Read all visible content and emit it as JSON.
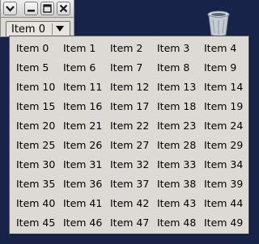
{
  "window": {
    "menu_icon": "chevron-down-icon",
    "minimize_icon": "minimize-icon",
    "maximize_icon": "maximize-icon",
    "close_icon": "close-icon"
  },
  "combo": {
    "selected": "Item 0",
    "arrow_icon": "dropdown-arrow-icon"
  },
  "desktop": {
    "trash_icon": "trash-icon",
    "background_color": "#18234a"
  },
  "popup": {
    "items": [
      "Item 0",
      "Item 1",
      "Item 2",
      "Item 3",
      "Item 4",
      "Item 5",
      "Item 6",
      "Item 7",
      "Item 8",
      "Item 9",
      "Item 10",
      "Item 11",
      "Item 12",
      "Item 13",
      "Item 14",
      "Item 15",
      "Item 16",
      "Item 17",
      "Item 18",
      "Item 19",
      "Item 20",
      "Item 21",
      "Item 22",
      "Item 23",
      "Item 24",
      "Item 25",
      "Item 26",
      "Item 27",
      "Item 28",
      "Item 29",
      "Item 30",
      "Item 31",
      "Item 32",
      "Item 33",
      "Item 34",
      "Item 35",
      "Item 36",
      "Item 37",
      "Item 38",
      "Item 39",
      "Item 40",
      "Item 41",
      "Item 42",
      "Item 43",
      "Item 44",
      "Item 45",
      "Item 46",
      "Item 47",
      "Item 48",
      "Item 49"
    ]
  }
}
